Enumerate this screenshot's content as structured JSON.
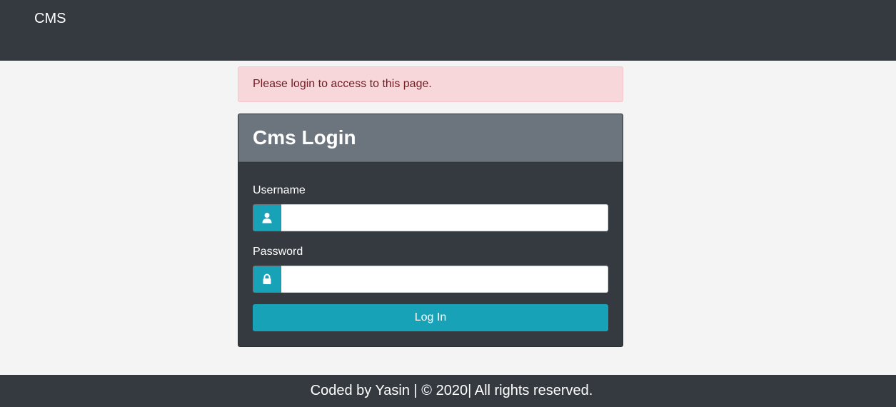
{
  "navbar": {
    "brand": "CMS"
  },
  "alert": {
    "message": "Please login to access to this page."
  },
  "login": {
    "title": "Cms Login",
    "username_label": "Username",
    "username_value": "",
    "username_icon": "user-icon",
    "password_label": "Password",
    "password_value": "",
    "password_icon": "lock-icon",
    "submit_label": "Log In"
  },
  "footer": {
    "text": "Coded by Yasin | © 2020| All rights reserved."
  },
  "colors": {
    "navbar": "#343a40",
    "card_header": "#6c757d",
    "accent": "#17a2b8",
    "alert_bg": "#f8d7da",
    "alert_text": "#721c24"
  }
}
